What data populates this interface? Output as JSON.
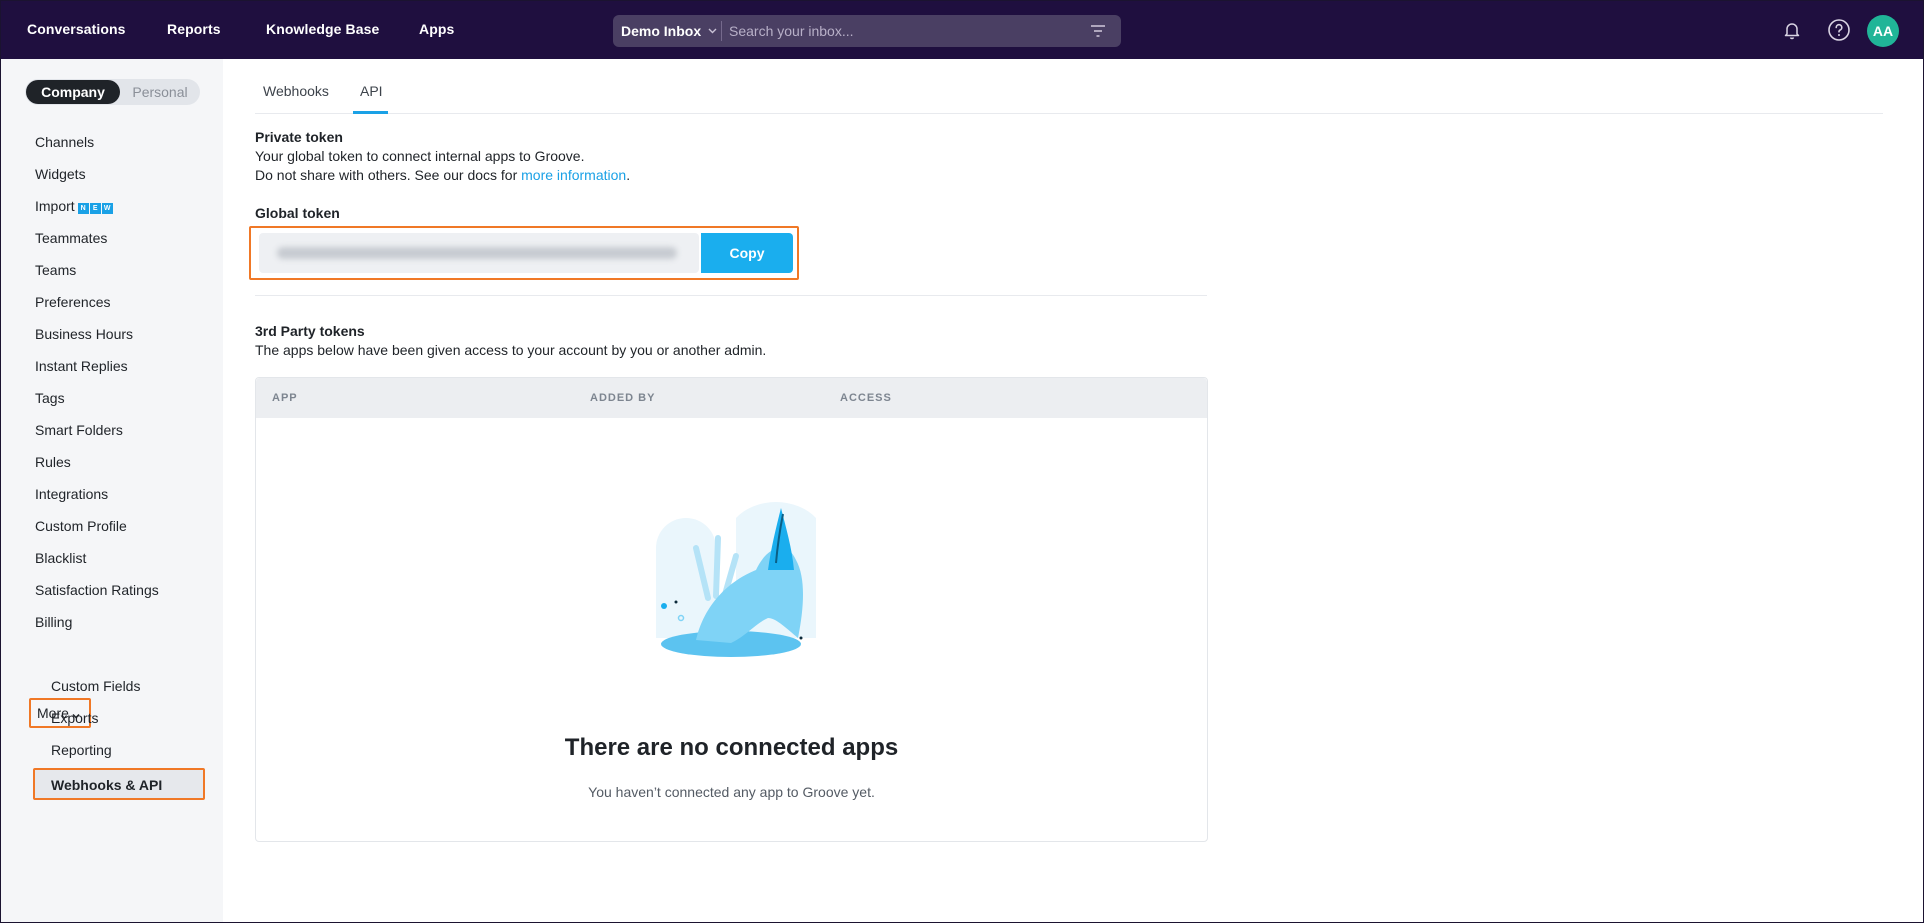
{
  "topnav": {
    "items": [
      "Conversations",
      "Reports",
      "Knowledge Base",
      "Apps"
    ],
    "inbox_selector": "Demo Inbox",
    "search_placeholder": "Search your inbox...",
    "avatar_initials": "AA",
    "icons": [
      "bell-icon",
      "help-icon",
      "filter-icon"
    ]
  },
  "sidebar": {
    "toggle": {
      "active": "Company",
      "inactive": "Personal"
    },
    "items": [
      "Channels",
      "Widgets",
      "Import",
      "Teammates",
      "Teams",
      "Preferences",
      "Business Hours",
      "Instant Replies",
      "Tags",
      "Smart Folders",
      "Rules",
      "Integrations",
      "Custom Profile",
      "Blacklist",
      "Satisfaction Ratings",
      "Billing"
    ],
    "import_badge": [
      "N",
      "E",
      "W"
    ],
    "more_label": "More",
    "sub_items": [
      "Custom Fields",
      "Exports",
      "Reporting"
    ],
    "active_item": "Webhooks & API"
  },
  "main": {
    "tabs": [
      "Webhooks",
      "API"
    ],
    "active_tab": "API",
    "private_token": {
      "heading": "Private token",
      "line1": "Your global token to connect internal apps to Groove.",
      "line2_prefix": "Do not share with others. See our docs for ",
      "line2_link": "more information",
      "line2_suffix": "."
    },
    "global_token": {
      "label": "Global token",
      "copy_label": "Copy"
    },
    "third_party": {
      "heading": "3rd Party tokens",
      "description": "The apps below have been given access to your account by you or another admin.",
      "columns": [
        "APP",
        "ADDED BY",
        "ACCESS"
      ],
      "empty_title": "There are no connected apps",
      "empty_subtitle": "You haven’t connected any app to Groove yet."
    }
  },
  "colors": {
    "topbar": "#1f0f3f",
    "accent": "#1aa1e6",
    "highlight": "#f07826",
    "avatar": "#20b598"
  }
}
